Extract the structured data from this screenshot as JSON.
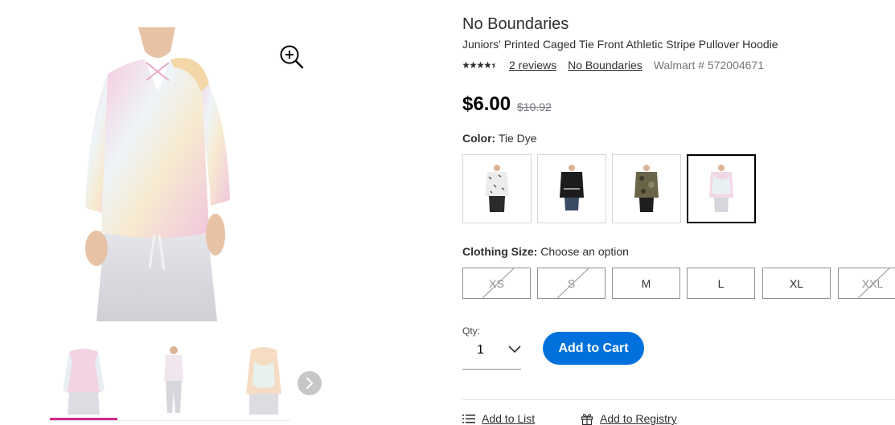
{
  "product": {
    "brand_title": "No Boundaries",
    "name": "Juniors' Printed Caged Tie Front Athletic Stripe Pullover Hoodie",
    "rating": 4.5,
    "reviews_label": "2 reviews",
    "brand_link": "No Boundaries",
    "item_number": "Walmart # 572004671",
    "price": "$6.00",
    "was_price": "$10.92"
  },
  "color": {
    "heading": "Color:",
    "selected": "Tie Dye",
    "swatches": [
      {
        "name": "white-print",
        "shirt": "#e9e9e9",
        "pants": "#2a2a2a"
      },
      {
        "name": "black",
        "shirt": "#1c1c1c",
        "pants": "#3b4a63"
      },
      {
        "name": "camo",
        "shirt": "#6a6548",
        "pants": "#1f1f1f"
      },
      {
        "name": "tie-dye",
        "shirt": "#f2d7e6",
        "pants": "#d6d6dc"
      }
    ]
  },
  "size": {
    "heading": "Clothing Size:",
    "prompt": "Choose an option",
    "options": [
      {
        "label": "XS",
        "available": false
      },
      {
        "label": "S",
        "available": false
      },
      {
        "label": "M",
        "available": true
      },
      {
        "label": "L",
        "available": true
      },
      {
        "label": "XL",
        "available": true
      },
      {
        "label": "XXL",
        "available": false
      }
    ]
  },
  "quantity": {
    "label": "Qty:",
    "value": "1"
  },
  "actions": {
    "add_to_cart": "Add to Cart",
    "add_to_list": "Add to List",
    "add_to_registry": "Add to Registry"
  },
  "icons": {
    "zoom": "zoom-in-icon",
    "next": "chevron-right-icon",
    "qty": "chevron-down-icon",
    "list": "list-icon",
    "registry": "gift-icon"
  },
  "colors": {
    "accent": "#0071dc",
    "active_thumb": "#d12c8a"
  }
}
